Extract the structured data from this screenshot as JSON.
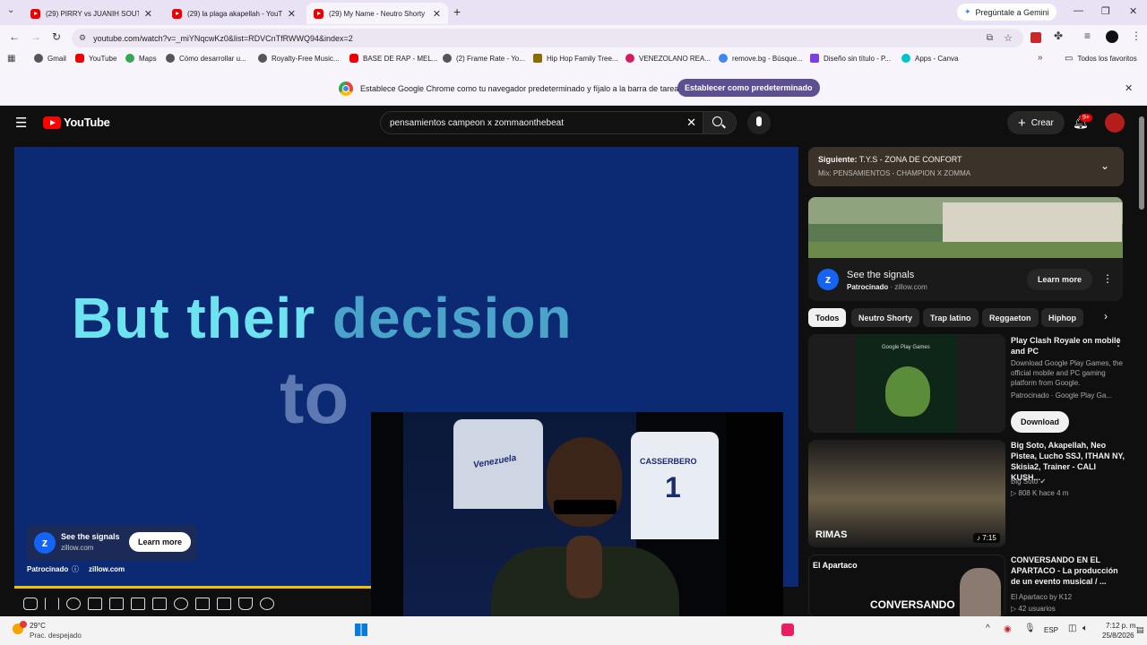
{
  "tabs": [
    {
      "label": "(29) PIRRY vs JUANIH SOUTH -",
      "active": false
    },
    {
      "label": "(29) la plaga akapellah - YouTub",
      "active": false
    },
    {
      "label": "(29) My Name - Neutro Shorty",
      "active": true
    }
  ],
  "gemini_label": "Pregúntale a Gemini",
  "url": "youtube.com/watch?v=_miYNqcwKz0&list=RDVCnTfRWWQ94&index=2",
  "bookmarks": [
    "Gmail",
    "YouTube",
    "Maps",
    "Cómo desarrollar u...",
    "Royalty-Free Music...",
    "BASE DE RAP - MEL...",
    "(2) Frame Rate - Yo...",
    "Hip Hop Family Tree...",
    "VENEZOLANO REA...",
    "remove.bg - Búsque...",
    "Diseño sin título - P...",
    "Apps - Canva"
  ],
  "all_bookmarks": "Todos los favoritos",
  "infobar": {
    "text": "Establece Google Chrome como tu navegador predeterminado y fíjalo a la barra de tareas",
    "button": "Establecer como predeterminado"
  },
  "yt": {
    "logo": "YouTube",
    "search_value": "pensamientos campeon x zommaonthebeat",
    "create": "Crear",
    "notif_badge": "9+"
  },
  "player": {
    "caption_line1a": "But their ",
    "caption_line1b": "decision",
    "caption_line2": "to",
    "ad_title": "See the signals",
    "ad_domain": "zillow.com",
    "ad_button": "Learn more",
    "sponsored": "Patrocinado",
    "sponsored_domain": "zillow.com"
  },
  "upnext": {
    "label": "Siguiente:",
    "title": "T.Y.S - ZONA DE CONFORT",
    "mix": "Mix: PENSAMIENTOS - CHAMPION X ZOMMA"
  },
  "side_ad": {
    "title": "See the signals",
    "sponsored": "Patrocinado",
    "domain": "zillow.com",
    "button": "Learn more"
  },
  "chips": [
    "Todos",
    "Neutro Shorty",
    "Trap latino",
    "Reggaeton",
    "Hiphop"
  ],
  "videos": [
    {
      "title": "Play Clash Royale on mobile and PC",
      "desc": "Download Google Play Games, the official mobile and PC gaming platform from Google.",
      "channel": "Patrocinado · Google Play Ga...",
      "button": "Download",
      "thumb_label": "Google Play Games"
    },
    {
      "title": "Big Soto, Akapellah, Neo Pistea, Lucho SSJ, ITHAN NY, Skisia2, Trainer - CALI KUSH...",
      "channel": "Big Soto",
      "meta": "808 K  hace 4 m",
      "duration": "7:15",
      "thumb_label": "RIMAS"
    },
    {
      "title": "CONVERSANDO EN EL APARTACO - La producción de un evento musical / ...",
      "channel": "El Apartaco by K12",
      "meta": "42 usuarios",
      "thumb_label": "CONVERSANDO",
      "thumb_label2": "El Apartaco"
    }
  ],
  "taskbar": {
    "temp": "29°C",
    "weather": "Prac. despejado",
    "lang": "ESP",
    "time": "7:12 p. m.",
    "date": "25/8/2026"
  },
  "pip": {
    "jersey_name": "CASSERBERO",
    "jersey_number": "1",
    "jersey2": "Venezuela"
  }
}
